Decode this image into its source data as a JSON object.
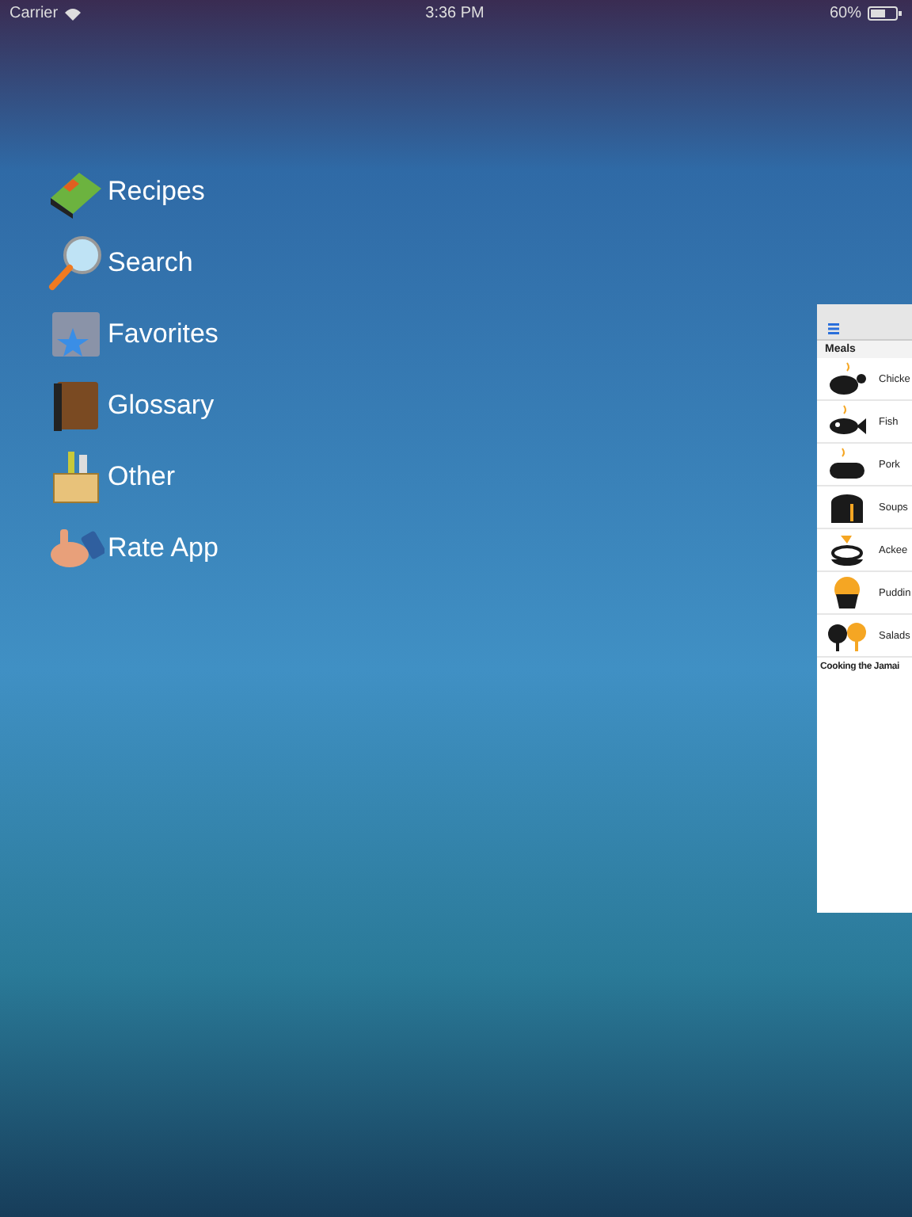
{
  "status_bar": {
    "carrier": "Carrier",
    "time": "3:36 PM",
    "battery": "60%"
  },
  "menu": [
    {
      "label": "Recipes",
      "kind": "book"
    },
    {
      "label": "Search",
      "kind": "magnifier"
    },
    {
      "label": "Favorites",
      "kind": "favorites"
    },
    {
      "label": "Glossary",
      "kind": "glossary"
    },
    {
      "label": "Other",
      "kind": "box"
    },
    {
      "label": "Rate App",
      "kind": "thumb"
    }
  ],
  "side_panel": {
    "section": "Meals",
    "items": [
      {
        "label": "Chicke",
        "kind": "chicken"
      },
      {
        "label": "Fish",
        "kind": "fish"
      },
      {
        "label": "Pork",
        "kind": "pork"
      },
      {
        "label": "Soups",
        "kind": "pot"
      },
      {
        "label": "Ackee",
        "kind": "bowl"
      },
      {
        "label": "Puddin",
        "kind": "pudding"
      },
      {
        "label": "Salads",
        "kind": "salad"
      }
    ],
    "footer": "Cooking the Jamai"
  }
}
